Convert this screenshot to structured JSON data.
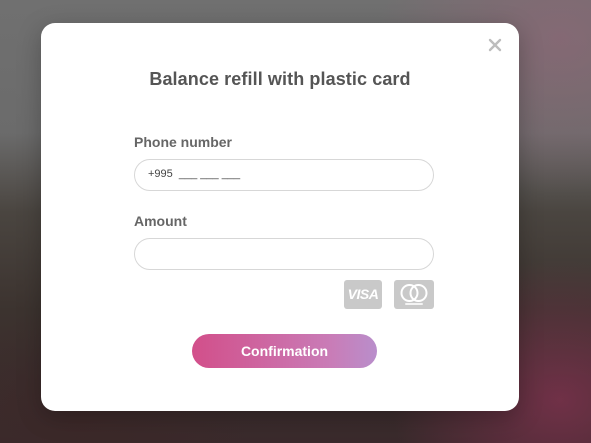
{
  "modal": {
    "title": "Balance refill with plastic card",
    "close_icon": "close-icon"
  },
  "form": {
    "phone": {
      "label": "Phone number",
      "value": "+995  ___ ___ ___"
    },
    "amount": {
      "label": "Amount",
      "value": ""
    }
  },
  "payment_methods": {
    "visa": {
      "text": "VISA",
      "icon": "visa-icon"
    },
    "mastercard": {
      "icon": "mastercard-icon"
    }
  },
  "actions": {
    "confirm_label": "Confirmation"
  },
  "colors": {
    "title": "#555555",
    "label": "#666666",
    "button_gradient_start": "#d24f8a",
    "button_gradient_end": "#b98ecb",
    "card_icon_bg": "#c9c9c9"
  }
}
